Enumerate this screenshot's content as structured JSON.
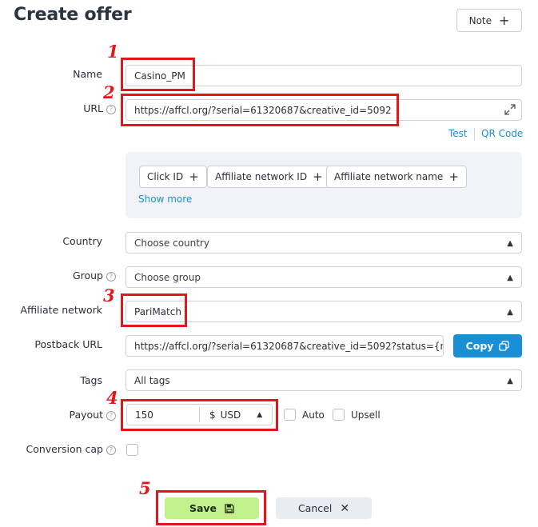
{
  "page": {
    "title": "Create offer"
  },
  "note_button": {
    "label": "Note",
    "icon": "plus-icon"
  },
  "fields": {
    "name": {
      "label": "Name",
      "value": "Casino_PM"
    },
    "url": {
      "label": "URL",
      "value": "https://affcl.org/?serial=61320687&creative_id=5092",
      "icon": "expand-icon"
    },
    "url_links": {
      "test": "Test",
      "qr": "QR Code"
    },
    "params": {
      "chips": [
        "Click ID",
        "Affiliate network ID",
        "Affiliate network name"
      ],
      "show_more": "Show more"
    },
    "country": {
      "label": "Country",
      "placeholder": "Choose country"
    },
    "group": {
      "label": "Group",
      "placeholder": "Choose group"
    },
    "affiliate_network": {
      "label": "Affiliate network",
      "value": "PariMatch"
    },
    "postback": {
      "label": "Postback URL",
      "value": "https://affcl.org/?serial=61320687&creative_id=5092?status={n",
      "copy_label": "Copy"
    },
    "tags": {
      "label": "Tags",
      "value": "All tags"
    },
    "payout": {
      "label": "Payout",
      "amount": "150",
      "currency_symbol": "$",
      "currency": "USD",
      "auto_label": "Auto",
      "upsell_label": "Upsell"
    },
    "conversion_cap": {
      "label": "Conversion cap"
    }
  },
  "actions": {
    "save": "Save",
    "cancel": "Cancel"
  },
  "annotations": {
    "n1": "1",
    "n2": "2",
    "n3": "3",
    "n4": "4",
    "n5": "5"
  },
  "colors": {
    "accent": "#1a8fd6",
    "save": "#c2f08c",
    "annotation": "#e3161c"
  }
}
